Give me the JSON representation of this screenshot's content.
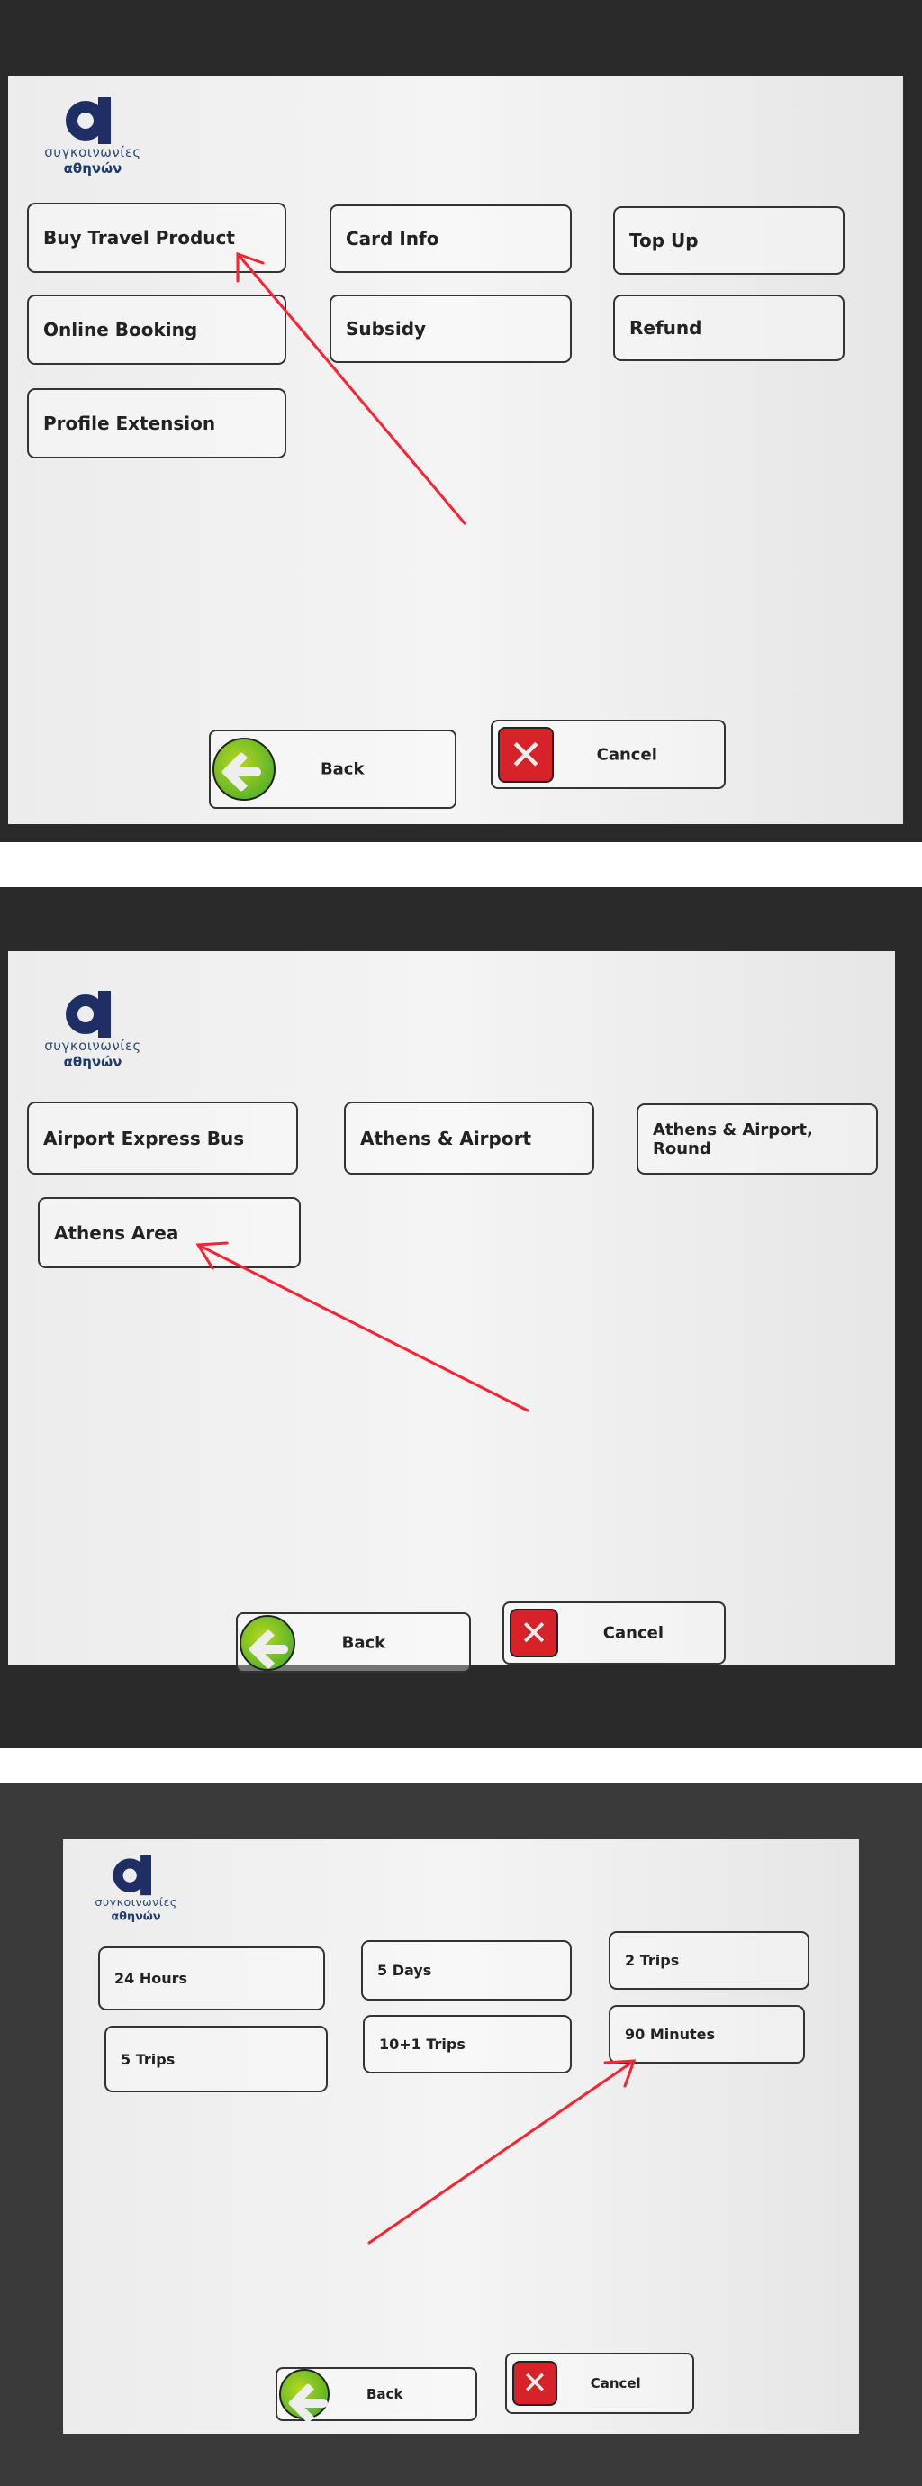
{
  "logo": {
    "line1": "συγκοινωνίες",
    "line2": "αθηνών",
    "color": "#1f2f66"
  },
  "screen1": {
    "buttons": [
      "Buy Travel Product",
      "Card Info",
      "Top Up",
      "Online Booking",
      "Subsidy",
      "Refund",
      "Profile Extension"
    ],
    "highlighted": "Buy Travel Product"
  },
  "screen2": {
    "buttons": [
      "Airport Express Bus",
      "Athens & Airport",
      "Athens & Airport, Round",
      "Athens Area"
    ],
    "highlighted": "Athens Area"
  },
  "screen3": {
    "buttons": [
      "24 Hours",
      "5 Days",
      "2 Trips",
      "5 Trips",
      "10+1 Trips",
      "90 Minutes"
    ],
    "highlighted": "90 Minutes"
  },
  "nav": {
    "back": "Back",
    "cancel": "Cancel",
    "back_icon": "arrow-left-circle-icon",
    "cancel_icon": "x-square-icon"
  },
  "colors": {
    "annotation_arrow": "#ff2030",
    "back_green": "#3aa62a",
    "cancel_red": "#d7222a"
  }
}
